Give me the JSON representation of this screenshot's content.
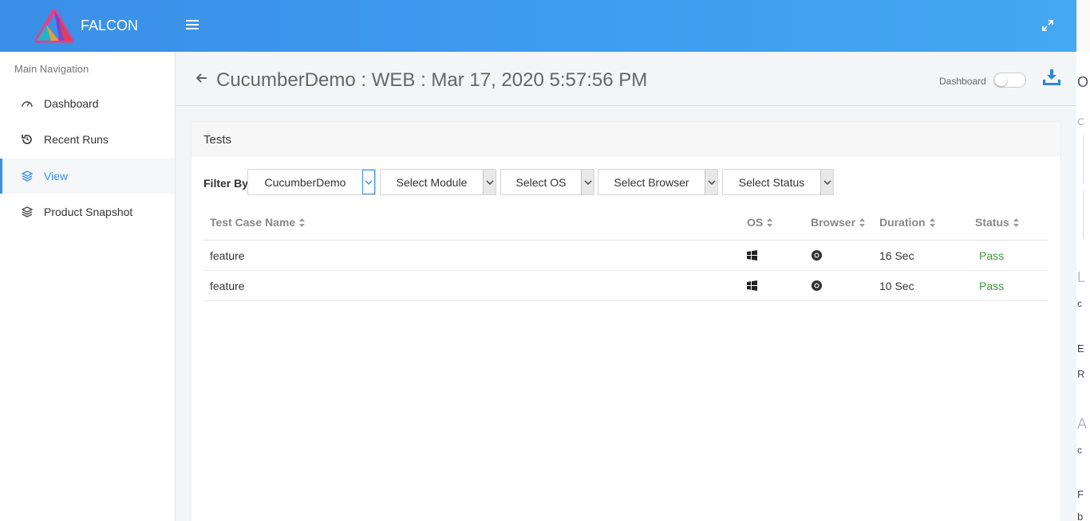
{
  "app": {
    "brand": "FALCON"
  },
  "sidebar": {
    "title": "Main Navigation",
    "items": [
      {
        "label": "Dashboard",
        "icon": "gauge-icon"
      },
      {
        "label": "Recent Runs",
        "icon": "history-icon"
      },
      {
        "label": "View",
        "icon": "layers-icon",
        "active": true
      },
      {
        "label": "Product Snapshot",
        "icon": "layers-icon"
      }
    ]
  },
  "header": {
    "title": "CucumberDemo : WEB : Mar 17, 2020 5:57:56 PM",
    "dashboard_label": "Dashboard"
  },
  "tests": {
    "card_title": "Tests",
    "filter_label": "Filter By",
    "filters": [
      "CucumberDemo",
      "Select Module",
      "Select OS",
      "Select Browser",
      "Select Status"
    ],
    "columns": [
      "Test Case Name",
      "OS",
      "Browser",
      "Duration",
      "Status"
    ],
    "rows": [
      {
        "name": "feature",
        "os": "windows-icon",
        "browser": "chrome-icon",
        "duration": "16 Sec",
        "status": "Pass"
      },
      {
        "name": "feature",
        "os": "windows-icon",
        "browser": "chrome-icon",
        "duration": "10 Sec",
        "status": "Pass"
      }
    ]
  },
  "right_panel": {
    "letters": [
      "O",
      "C",
      "L",
      "c",
      "E",
      "R",
      "A",
      "c",
      "F",
      "b"
    ]
  },
  "colors": {
    "accent": "#3a8fe6",
    "pass": "#3a9a3a"
  }
}
